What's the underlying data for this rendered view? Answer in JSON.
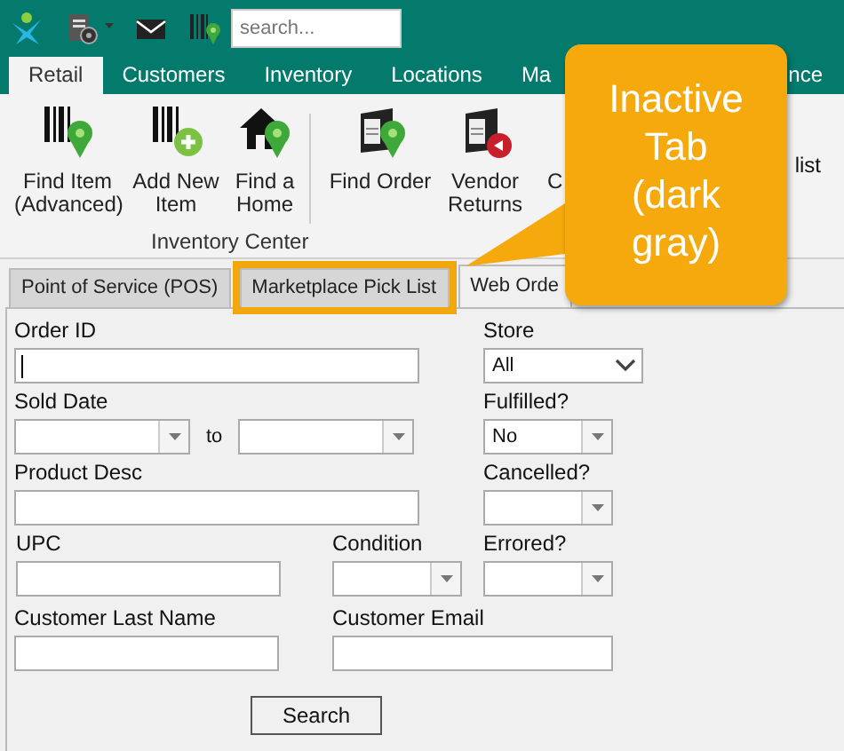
{
  "toolbar": {
    "search": {
      "placeholder": "search..."
    }
  },
  "ribbon_tabs": [
    {
      "label": "Retail",
      "selected": true
    },
    {
      "label": "Customers",
      "selected": false
    },
    {
      "label": "Inventory",
      "selected": false
    },
    {
      "label": "Locations",
      "selected": false
    },
    {
      "label": "Ma",
      "selected": false
    },
    {
      "label": "nce",
      "selected": false
    }
  ],
  "ribbon": {
    "buttons": [
      {
        "label": "Find Item (Advanced)",
        "kind": "find-item"
      },
      {
        "label": "Add New Item",
        "kind": "add-item"
      },
      {
        "label": "Find a Home",
        "kind": "home"
      },
      {
        "kind": "separator"
      },
      {
        "label": "Find Order",
        "kind": "find-order"
      },
      {
        "label": "Vendor Returns",
        "kind": "returns"
      },
      {
        "label": "C",
        "kind": "hidden"
      }
    ],
    "group_label": "Inventory Center",
    "extra_label": "list"
  },
  "page_tabs": [
    {
      "label": "Point of Service (POS)",
      "selected": false,
      "highlighted": false
    },
    {
      "label": "Marketplace Pick List",
      "selected": false,
      "highlighted": true
    },
    {
      "label": "Web Orde",
      "selected": true,
      "highlighted": false
    }
  ],
  "form": {
    "rows": [
      [
        {
          "label": "Order ID",
          "kind": "text",
          "focused": true
        },
        {
          "label": "Store",
          "kind": "select",
          "value": "All"
        }
      ],
      [
        {
          "label": "Sold Date",
          "kind": "date-range",
          "separator": "to"
        },
        {
          "label": "Fulfilled?",
          "kind": "combo",
          "value": "No"
        }
      ],
      [
        {
          "label": "Product Desc",
          "kind": "text"
        },
        {
          "label": "Cancelled?",
          "kind": "combo"
        }
      ],
      [
        {
          "label": "UPC",
          "kind": "text"
        },
        {
          "label": "Condition",
          "kind": "combo"
        },
        {
          "label": "Errored?",
          "kind": "combo"
        }
      ],
      [
        {
          "label": "Customer Last Name",
          "kind": "text"
        },
        {
          "label": "Customer Email",
          "kind": "text"
        }
      ]
    ],
    "button": "Search"
  },
  "callout": {
    "text": "Inactive Tab (dark gray)"
  }
}
